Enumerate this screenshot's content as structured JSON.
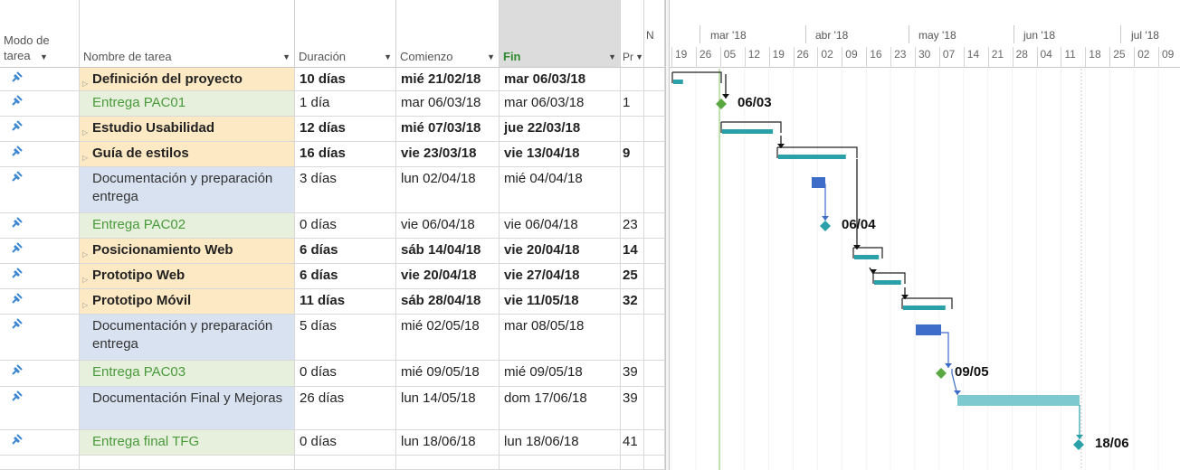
{
  "columns": {
    "mode": "Modo de tarea",
    "name": "Nombre de tarea",
    "duration": "Duración",
    "start": "Comienzo",
    "end": "Fin",
    "predecessors": "Pr",
    "resources": "N"
  },
  "timescale": {
    "months": [
      "mar '18",
      "abr '18",
      "may '18",
      "jun '18",
      "jul '18"
    ],
    "weeks": [
      "19",
      "26",
      "05",
      "12",
      "19",
      "26",
      "02",
      "09",
      "16",
      "23",
      "30",
      "07",
      "14",
      "21",
      "28",
      "04",
      "11",
      "18",
      "25",
      "02",
      "09"
    ]
  },
  "tasks": [
    {
      "name": "Definición del proyecto",
      "type": "summary",
      "duration": "10 días",
      "start": "mié 21/02/18",
      "end": "mar 06/03/18",
      "pred": ""
    },
    {
      "name": "Entrega PAC01",
      "type": "milestone",
      "duration": "1 día",
      "start": "mar 06/03/18",
      "end": "mar 06/03/18",
      "pred": "1",
      "label": "06/03"
    },
    {
      "name": "Estudio Usabilidad",
      "type": "summary",
      "duration": "12 días",
      "start": "mié 07/03/18",
      "end": "jue 22/03/18",
      "pred": ""
    },
    {
      "name": "Guía de estilos",
      "type": "summary",
      "duration": "16 días",
      "start": "vie 23/03/18",
      "end": "vie 13/04/18",
      "pred": "9"
    },
    {
      "name": "Documentación y preparación entrega",
      "type": "task",
      "duration": "3 días",
      "start": "lun 02/04/18",
      "end": "mié 04/04/18",
      "pred": ""
    },
    {
      "name": "Entrega PAC02",
      "type": "milestone",
      "duration": "0 días",
      "start": "vie 06/04/18",
      "end": "vie 06/04/18",
      "pred": "23",
      "label": "06/04"
    },
    {
      "name": "Posicionamiento Web",
      "type": "summary",
      "duration": "6 días",
      "start": "sáb 14/04/18",
      "end": "vie 20/04/18",
      "pred": "14"
    },
    {
      "name": "Prototipo Web",
      "type": "summary",
      "duration": "6 días",
      "start": "vie 20/04/18",
      "end": "vie 27/04/18",
      "pred": "25"
    },
    {
      "name": "Prototipo Móvil",
      "type": "summary",
      "duration": "11 días",
      "start": "sáb 28/04/18",
      "end": "vie 11/05/18",
      "pred": "32"
    },
    {
      "name": "Documentación y preparación entrega",
      "type": "task",
      "duration": "5 días",
      "start": "mié 02/05/18",
      "end": "mar 08/05/18",
      "pred": ""
    },
    {
      "name": "Entrega PAC03",
      "type": "milestone",
      "duration": "0 días",
      "start": "mié 09/05/18",
      "end": "mié 09/05/18",
      "pred": "39",
      "label": "09/05"
    },
    {
      "name": "Documentación Final y Mejoras",
      "type": "task",
      "duration": "26 días",
      "start": "lun 14/05/18",
      "end": "dom 17/06/18",
      "pred": "39"
    },
    {
      "name": "Entrega final TFG",
      "type": "milestone",
      "duration": "0 días",
      "start": "lun 18/06/18",
      "end": "lun 18/06/18",
      "pred": "41",
      "label": "18/06"
    }
  ],
  "colors": {
    "summary_bg": "#fde9c4",
    "milestone_bg": "#e6f0dc",
    "task_bg": "#d9e2f1",
    "summary_bar": "#2aa1a8",
    "task_bar": "#3e6cc9",
    "milestone_marker": "#5aa842",
    "today_line": "#8dc96a"
  }
}
